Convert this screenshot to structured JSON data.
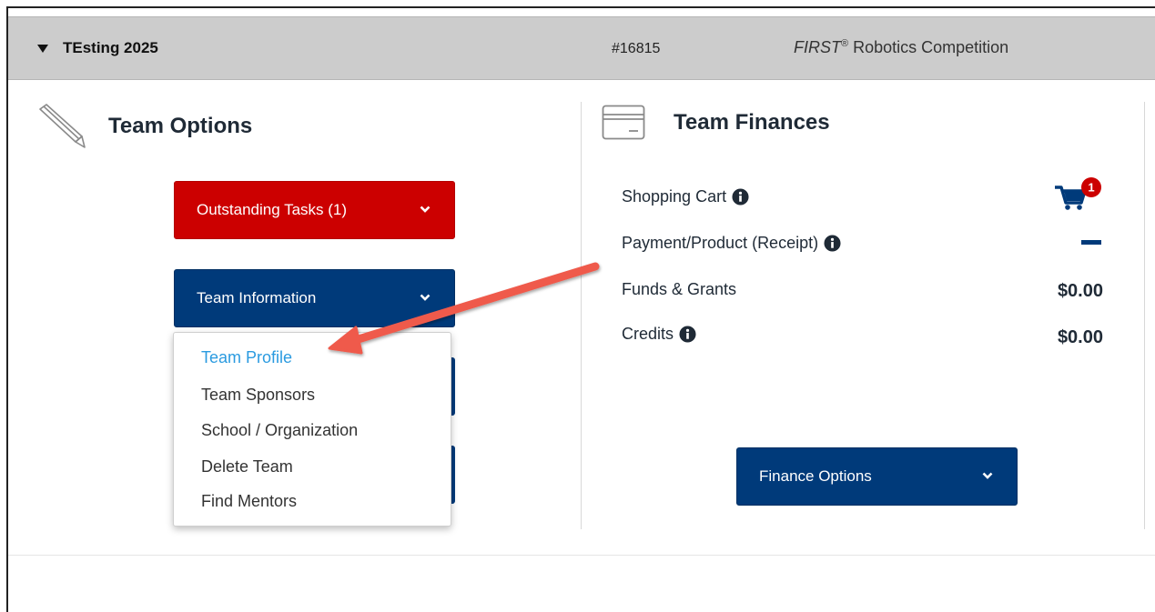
{
  "header": {
    "title": "TEsting 2025",
    "team_number": "#16815",
    "program_first": "FIRST",
    "program_reg": "®",
    "program_rest": " Robotics Competition"
  },
  "team_options": {
    "title": "Team Options",
    "outstanding_tasks_label": "Outstanding Tasks (1)",
    "team_information_label": "Team Information",
    "menu_items": [
      "Team Profile",
      "Team Sponsors",
      "School / Organization",
      "Delete Team",
      "Find Mentors"
    ],
    "active_item": "Team Profile"
  },
  "team_finances": {
    "title": "Team Finances",
    "rows": [
      {
        "label": "Shopping Cart",
        "value": ""
      },
      {
        "label": "Payment/Product (Receipt)",
        "value": ""
      },
      {
        "label": "Funds & Grants",
        "value": "$0.00"
      },
      {
        "label": "Credits",
        "value": "$0.00"
      }
    ],
    "cart_badge": "1",
    "finance_options_label": "Finance Options"
  },
  "colors": {
    "red_button": "#cc0000",
    "navy_button": "#003a7a",
    "active_link": "#2b9be0",
    "badge": "#cc0000",
    "arrow": "#ef5a4c"
  },
  "icons": {
    "header_toggle": "caret-down-icon",
    "team_options": "pen-icon",
    "team_finances": "credit-card-icon",
    "info": "info-circle-icon",
    "cart": "shopping-cart-icon",
    "chevron": "chevron-down-icon",
    "annotation": "annotation-arrow"
  }
}
